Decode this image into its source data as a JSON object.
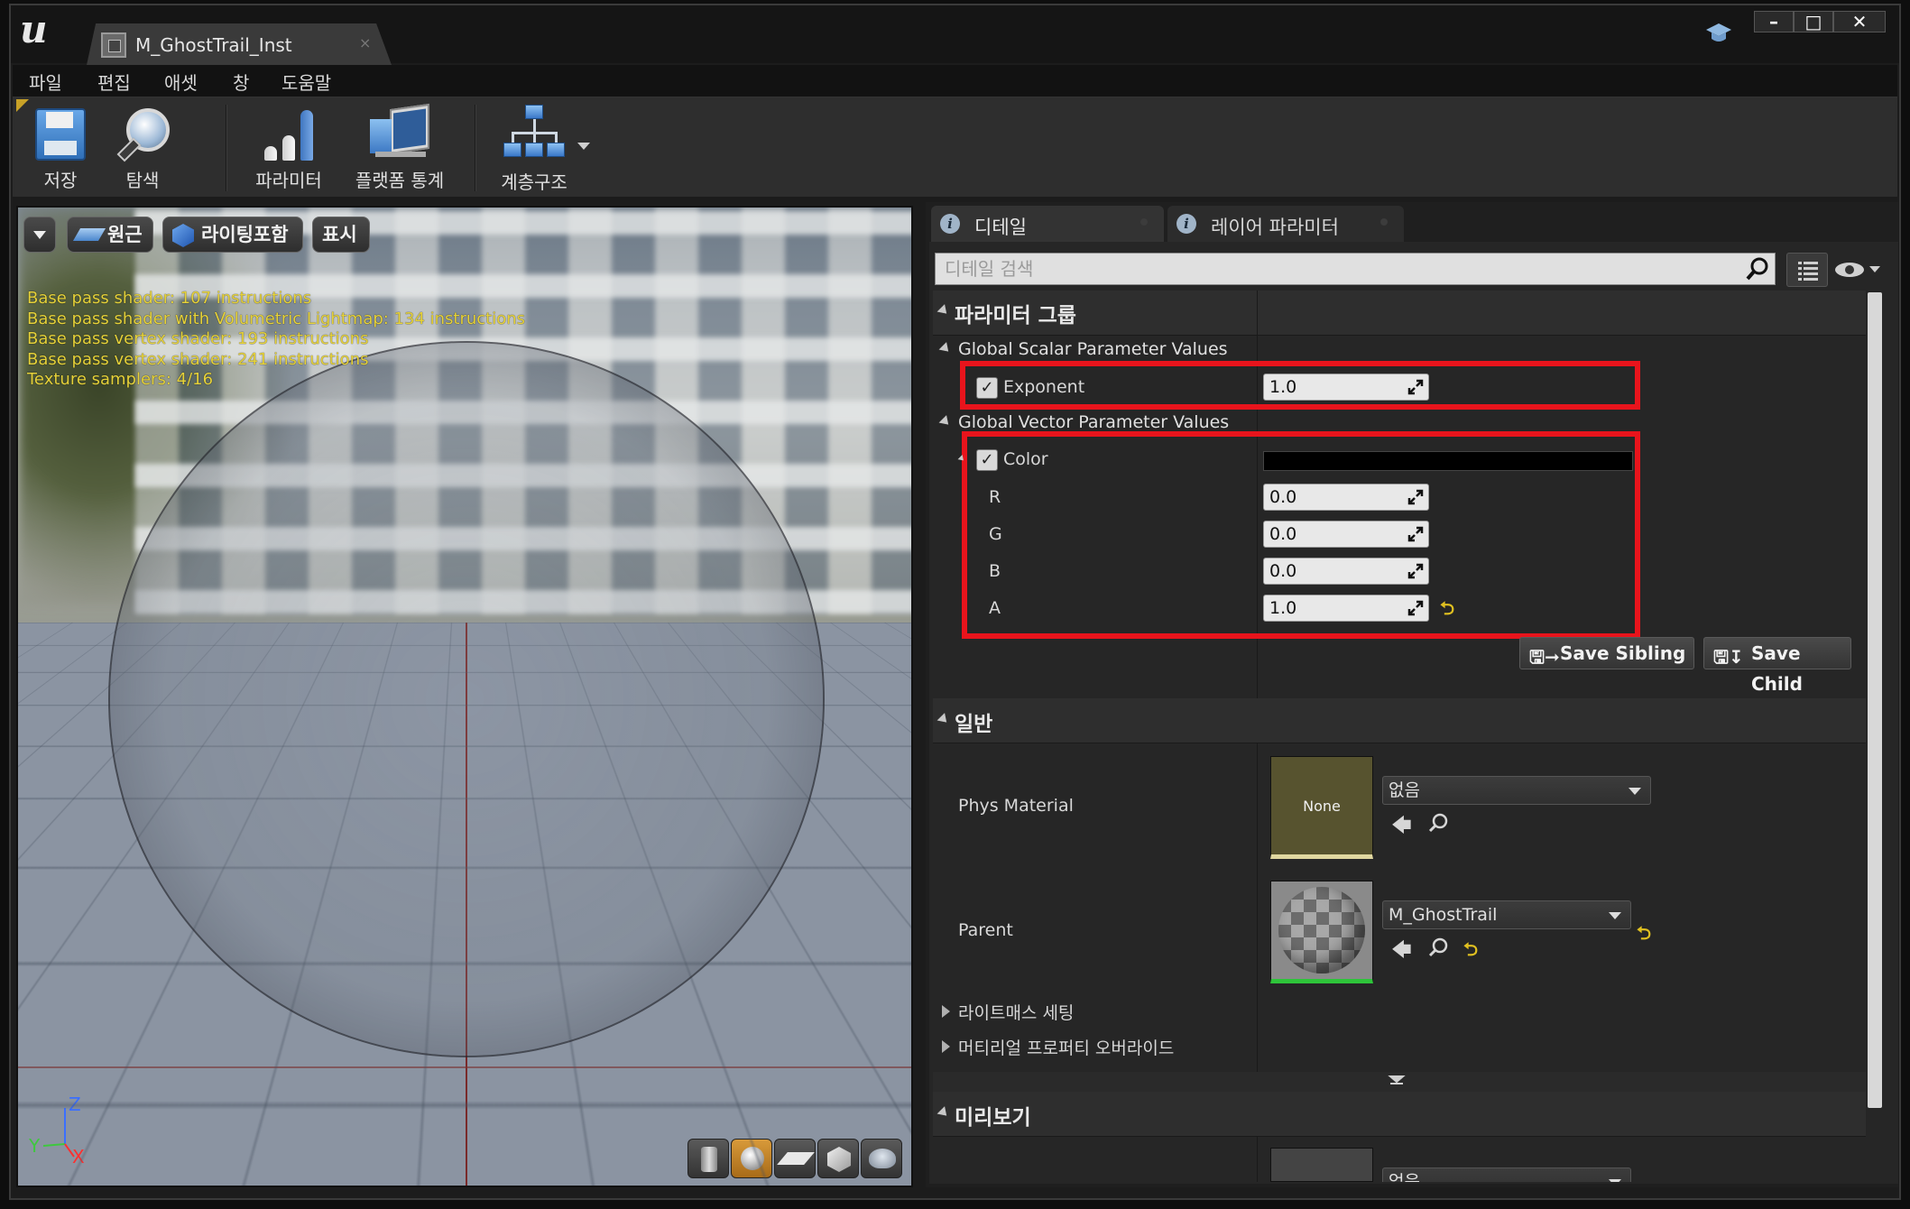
{
  "window": {
    "tab_title": "M_GhostTrail_Inst",
    "tab_close": "×",
    "controls": {
      "minimize": "–",
      "maximize": "□",
      "close": "✕"
    }
  },
  "menu": [
    "파일",
    "편집",
    "애셋",
    "창",
    "도움말"
  ],
  "toolbar": {
    "save": "저장",
    "browse": "탐색",
    "params": "파라미터",
    "platform_stats": "플랫폼 통계",
    "hierarchy": "계층구조"
  },
  "viewport": {
    "buttons": {
      "perspective": "원근",
      "lit": "라이팅포함",
      "show": "표시"
    },
    "stats": [
      "Base pass shader: 107 instructions",
      "Base pass shader with Volumetric Lightmap: 134 instructions",
      "Base pass vertex shader: 193 instructions",
      "Base pass vertex shader: 241 instructions",
      "Texture samplers: 4/16"
    ],
    "axes": {
      "z": "Z",
      "y": "Y",
      "x": "X"
    }
  },
  "details": {
    "tabs": [
      {
        "label": "디테일",
        "icon": "info-icon"
      },
      {
        "label": "레이어 파라미터",
        "icon": "info-icon"
      }
    ],
    "search_placeholder": "디테일 검색",
    "param_group": {
      "title": "파라미터 그룹",
      "scalar_header": "Global Scalar Parameter Values",
      "exponent": {
        "label": "Exponent",
        "value": "1.0",
        "checked": true
      },
      "vector_header": "Global Vector Parameter Values",
      "color": {
        "label": "Color",
        "checked": true,
        "swatch": "#000000",
        "r": {
          "label": "R",
          "value": "0.0"
        },
        "g": {
          "label": "G",
          "value": "0.0"
        },
        "b": {
          "label": "B",
          "value": "0.0"
        },
        "a": {
          "label": "A",
          "value": "1.0"
        }
      },
      "save_sibling": "Save Sibling",
      "save_child": "Save Child"
    },
    "general": {
      "title": "일반",
      "phys_material": {
        "label": "Phys Material",
        "thumb_text": "None",
        "value": "없음"
      },
      "parent": {
        "label": "Parent",
        "value": "M_GhostTrail"
      },
      "lightmass": "라이트매스 세팅",
      "material_override": "머티리얼 프로퍼티 오버라이드"
    },
    "preview": {
      "title": "미리보기",
      "value": "없음"
    }
  },
  "colors": {
    "highlight": "#e8141c",
    "stats_text": "#e6d23a",
    "reset_arrow": "#e0c020"
  }
}
